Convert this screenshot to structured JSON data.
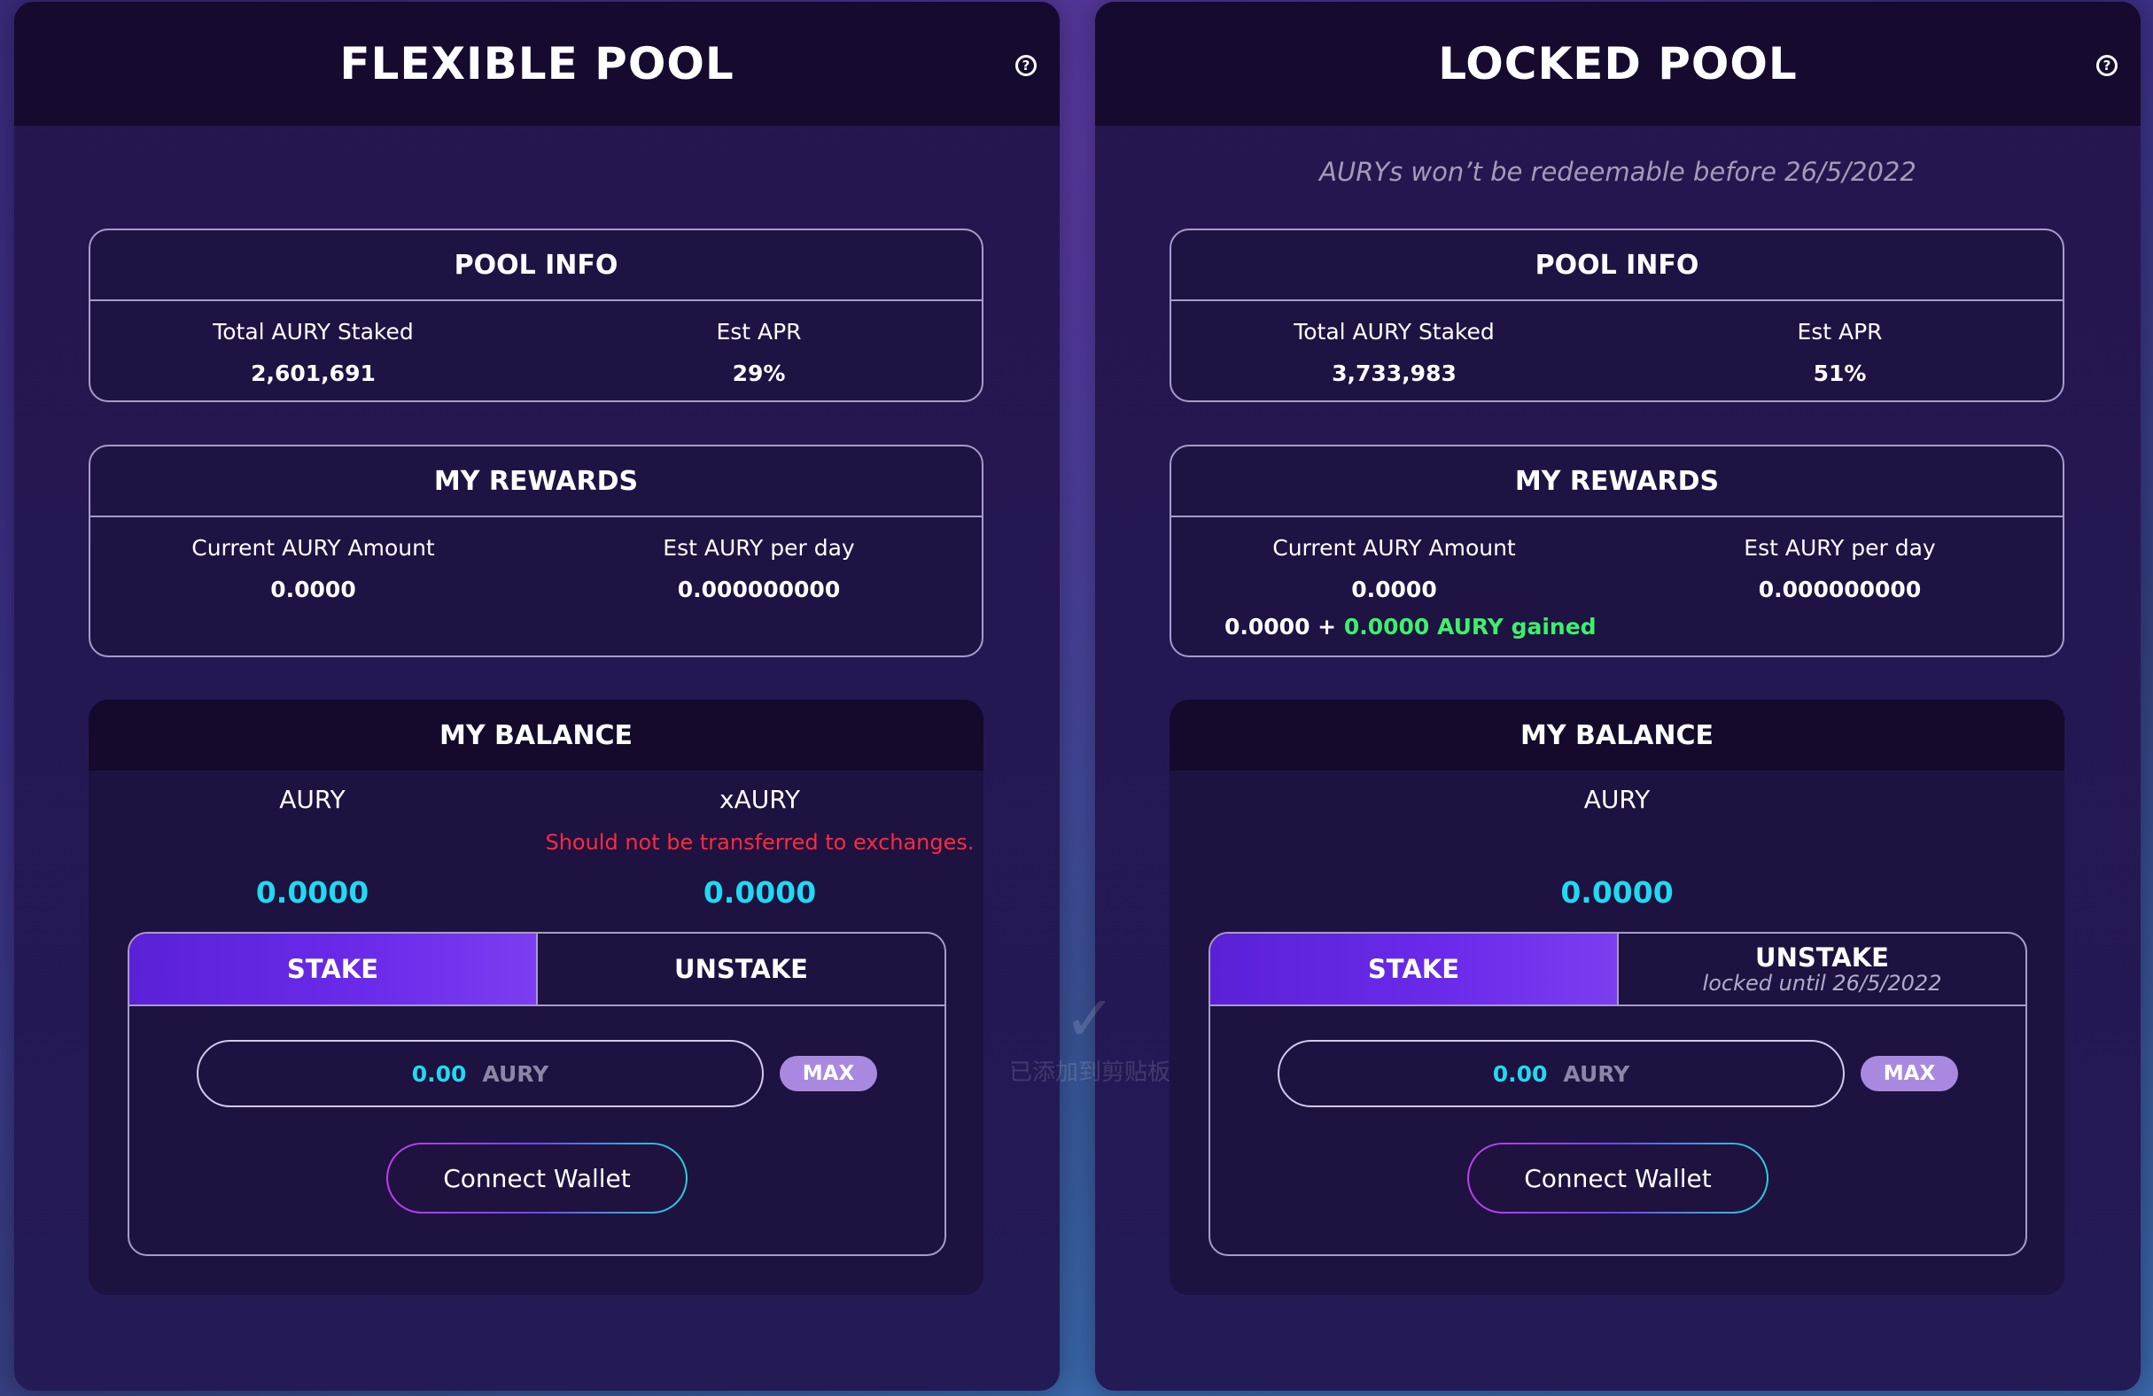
{
  "flexible": {
    "title": "FLEXIBLE POOL",
    "help_icon": "?",
    "pool_info": {
      "header": "POOL INFO",
      "total_label": "Total AURY Staked",
      "total_value": "2,601,691",
      "apr_label": "Est APR",
      "apr_value": "29%"
    },
    "rewards": {
      "header": "MY REWARDS",
      "current_label": "Current AURY Amount",
      "current_value": "0.0000",
      "per_day_label": "Est AURY per day",
      "per_day_value": "0.000000000"
    },
    "balance": {
      "header": "MY BALANCE",
      "aury_label": "AURY",
      "aury_value": "0.0000",
      "xaury_label": "xAURY",
      "xaury_warning": "Should not be transferred to exchanges.",
      "xaury_value": "0.0000"
    },
    "stake": {
      "tab_stake": "STAKE",
      "tab_unstake": "UNSTAKE",
      "amount": "0.00",
      "unit": "AURY",
      "max_label": "MAX",
      "connect_label": "Connect Wallet"
    }
  },
  "locked": {
    "title": "LOCKED POOL",
    "help_icon": "?",
    "notice": "AURYs won’t be redeemable before 26/5/2022",
    "pool_info": {
      "header": "POOL INFO",
      "total_label": "Total AURY Staked",
      "total_value": "3,733,983",
      "apr_label": "Est APR",
      "apr_value": "51%"
    },
    "rewards": {
      "header": "MY REWARDS",
      "current_label": "Current AURY Amount",
      "current_value": "0.0000",
      "per_day_label": "Est AURY per day",
      "per_day_value": "0.000000000",
      "gain_base": "0.0000 + ",
      "gain_green": "0.0000 AURY gained"
    },
    "balance": {
      "header": "MY BALANCE",
      "aury_label": "AURY",
      "aury_value": "0.0000"
    },
    "stake": {
      "tab_stake": "STAKE",
      "tab_unstake": "UNSTAKE",
      "unstake_sub": "locked until 26/5/2022",
      "amount": "0.00",
      "unit": "AURY",
      "max_label": "MAX",
      "connect_label": "Connect Wallet"
    }
  },
  "overlay": {
    "check": "✓",
    "text": "已添加到剪贴板"
  },
  "colors": {
    "accent_cyan": "#21d9f0",
    "warning_red": "#ff2a3d",
    "gain_green": "#3df06a",
    "tab_purple": "#5a21d6"
  }
}
